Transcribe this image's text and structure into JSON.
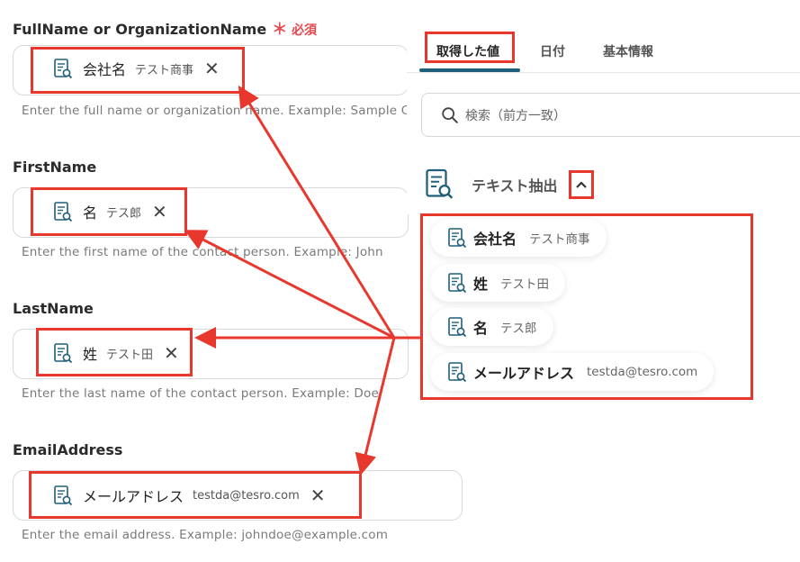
{
  "form": {
    "fields": [
      {
        "label": "FullName or OrganizationName",
        "required_mark": "＊",
        "required_text": "必須",
        "chip_name": "会社名",
        "chip_value": "テスト商事",
        "help": "Enter the full name or organization name. Example: Sample C"
      },
      {
        "label": "FirstName",
        "chip_name": "名",
        "chip_value": "テス郎",
        "help": "Enter the first name of the contact person. Example: John"
      },
      {
        "label": "LastName",
        "chip_name": "姓",
        "chip_value": "テスト田",
        "help": "Enter the last name of the contact person. Example: Doe"
      },
      {
        "label": "EmailAddress",
        "chip_name": "メールアドレス",
        "chip_value": "testda@tesro.com",
        "help": "Enter the email address. Example: johndoe@example.com"
      }
    ],
    "remove_glyph": "✕"
  },
  "panel": {
    "tabs": [
      "取得した値",
      "日付",
      "基本情報"
    ],
    "search_placeholder": "検索（前方一致）",
    "group_title": "テキスト抽出",
    "items": [
      {
        "name": "会社名",
        "value": "テスト商事"
      },
      {
        "name": "姓",
        "value": "テスト田"
      },
      {
        "name": "名",
        "value": "テス郎"
      },
      {
        "name": "メールアドレス",
        "value": "testda@tesro.com"
      }
    ]
  },
  "colors": {
    "highlight": "#e8382e",
    "icon": "#1f5f7a",
    "accent_tab": "#1f5f7a"
  },
  "icons": {
    "chip": "document-search-icon",
    "search": "search-icon",
    "collapse": "chevron-up-icon",
    "remove": "close-icon"
  }
}
